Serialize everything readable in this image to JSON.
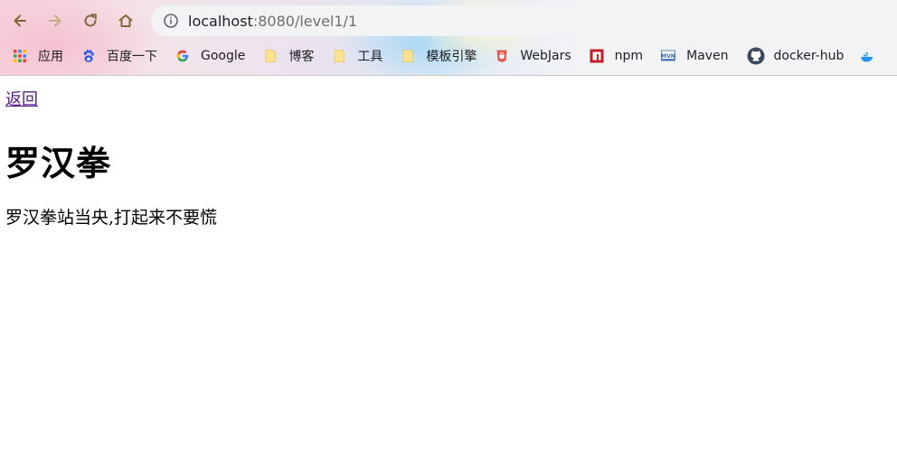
{
  "browser": {
    "url_host": "localhost",
    "url_rest": ":8080/level1/1"
  },
  "bookmarks": [
    {
      "label": "应用",
      "icon": "apps-grid-icon"
    },
    {
      "label": "百度一下",
      "icon": "baidu-paw-icon"
    },
    {
      "label": "Google",
      "icon": "google-g-icon"
    },
    {
      "label": "博客",
      "icon": "folder-icon"
    },
    {
      "label": "工具",
      "icon": "folder-icon"
    },
    {
      "label": "模板引擎",
      "icon": "folder-icon"
    },
    {
      "label": "WebJars",
      "icon": "webjars-icon"
    },
    {
      "label": "npm",
      "icon": "npm-icon"
    },
    {
      "label": "Maven",
      "icon": "maven-icon"
    },
    {
      "label": "docker-hub",
      "icon": "github-icon"
    }
  ],
  "page": {
    "back_link": "返回",
    "title": "罗汉拳",
    "text": "罗汉拳站当央,打起来不要慌"
  },
  "colors": {
    "link_visited": "#551a8b",
    "nav_icon": "#8a6a2a",
    "omnibox_bg": "#f1f3f4"
  }
}
